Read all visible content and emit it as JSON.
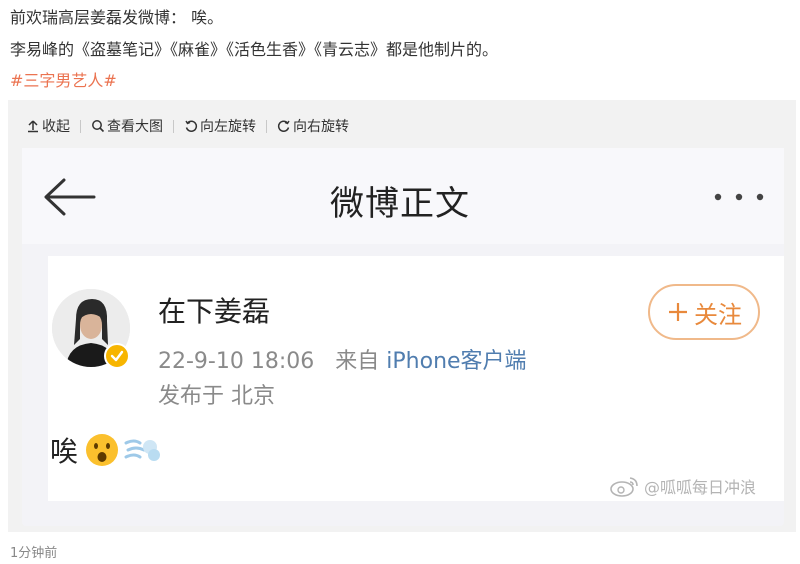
{
  "post": {
    "line1": "前欢瑞高层姜磊发微博： 唉。",
    "line2": "李易峰的《盗墓笔记》《麻雀》《活色生香》《青云志》都是他制片的。",
    "hashtag": "#三字男艺人#",
    "timestamp": "1分钟前"
  },
  "image_toolbar": {
    "collapse": "收起",
    "view_large": "查看大图",
    "rotate_left": "向左旋转",
    "rotate_right": "向右旋转"
  },
  "screenshot": {
    "header_title": "微博正文",
    "username": "在下姜磊",
    "time": "22-9-10 18:06",
    "from_prefix": "来自",
    "source": "iPhone客户端",
    "location": "发布于 北京",
    "follow_label": "关注",
    "content": "唉",
    "watermark": "@呱呱每日冲浪"
  },
  "colors": {
    "tag": "#eb7350",
    "follow": "#e8893c",
    "verified_badge": "#f7b500",
    "source_link": "#507daf"
  },
  "icons": [
    "upload-icon",
    "magnify-icon",
    "rotate-left-icon",
    "rotate-right-icon",
    "back-arrow-icon",
    "more-dots-icon",
    "verified-badge-icon",
    "surprised-face-icon",
    "dash-icon",
    "weibo-logo-icon"
  ]
}
